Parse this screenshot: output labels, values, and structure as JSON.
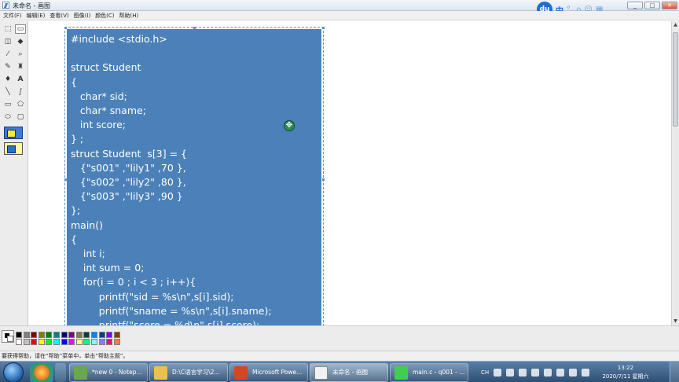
{
  "window": {
    "title": "未命名 - 画图",
    "minimize": "_",
    "restore": "□",
    "close": "✕"
  },
  "ime": {
    "du": "du",
    "items": [
      "中",
      "°,",
      "⌂",
      "☺",
      "▦"
    ]
  },
  "menu": [
    "文件(F)",
    "编辑(E)",
    "查看(V)",
    "图像(I)",
    "颜色(C)",
    "帮助(H)"
  ],
  "tools": [
    {
      "name": "free-select-icon",
      "glyph": "⬚"
    },
    {
      "name": "select-icon",
      "glyph": "▭"
    },
    {
      "name": "eraser-icon",
      "glyph": "◫"
    },
    {
      "name": "fill-icon",
      "glyph": "◆"
    },
    {
      "name": "color-picker-icon",
      "glyph": "⁄"
    },
    {
      "name": "magnifier-icon",
      "glyph": "⌕"
    },
    {
      "name": "pencil-icon",
      "glyph": "✎"
    },
    {
      "name": "brush-icon",
      "glyph": "♜"
    },
    {
      "name": "airbrush-icon",
      "glyph": "♦"
    },
    {
      "name": "text-icon",
      "glyph": "A"
    },
    {
      "name": "line-icon",
      "glyph": "╲"
    },
    {
      "name": "curve-icon",
      "glyph": "∫"
    },
    {
      "name": "rectangle-icon",
      "glyph": "▭"
    },
    {
      "name": "polygon-icon",
      "glyph": "⬠"
    },
    {
      "name": "ellipse-icon",
      "glyph": "⬭"
    },
    {
      "name": "rounded-rect-icon",
      "glyph": "▢"
    }
  ],
  "code": "#include <stdio.h>\n\nstruct Student\n{\n   char* sid;\n   char* sname;\n   int score;\n} ;\nstruct Student  s[3] = {\n   {\"s001\" ,\"lily1\" ,70 },\n   {\"s002\" ,\"lily2\" ,80 },\n   {\"s003\" ,\"lily3\" ,90 }\n};\nmain()\n{\n    int i;\n    int sum = 0;\n    for(i = 0 ; i < 3 ; i++){\n         printf(\"sid = %s\\n\",s[i].sid);\n         printf(\"sname = %s\\n\",s[i].sname);\n         printf(\"score = %d\\n\",s[i].score);",
  "cursor": "✥",
  "palette": {
    "row1": [
      "#000000",
      "#808080",
      "#800000",
      "#808000",
      "#008000",
      "#008080",
      "#000080",
      "#800080",
      "#808040",
      "#004040",
      "#0080ff",
      "#004080",
      "#8000ff",
      "#804000"
    ],
    "row2": [
      "#ffffff",
      "#c0c0c0",
      "#ff0000",
      "#ffff00",
      "#00ff00",
      "#00ffff",
      "#0000ff",
      "#ff00ff",
      "#ffff80",
      "#00ff80",
      "#80ffff",
      "#8080ff",
      "#ff0080",
      "#ff8040"
    ]
  },
  "status": "要获得帮助，请在“帮助”菜单中，单击“帮助主题”。",
  "taskbar": {
    "tasks": [
      {
        "label": "*new  0 - Notep...",
        "color": "#6aa84f"
      },
      {
        "label": "D:\\C语言学习\\2...",
        "color": "#e6c34a"
      },
      {
        "label": "Microsoft Powe...",
        "color": "#d24726"
      },
      {
        "label": "未命名 - 画图",
        "color": "#f2f2f2"
      },
      {
        "label": "main.c - q001 - ...",
        "color": "#41cd52"
      }
    ],
    "lang": "CH",
    "time": "13:22",
    "date": "2020/7/11 星期六"
  }
}
